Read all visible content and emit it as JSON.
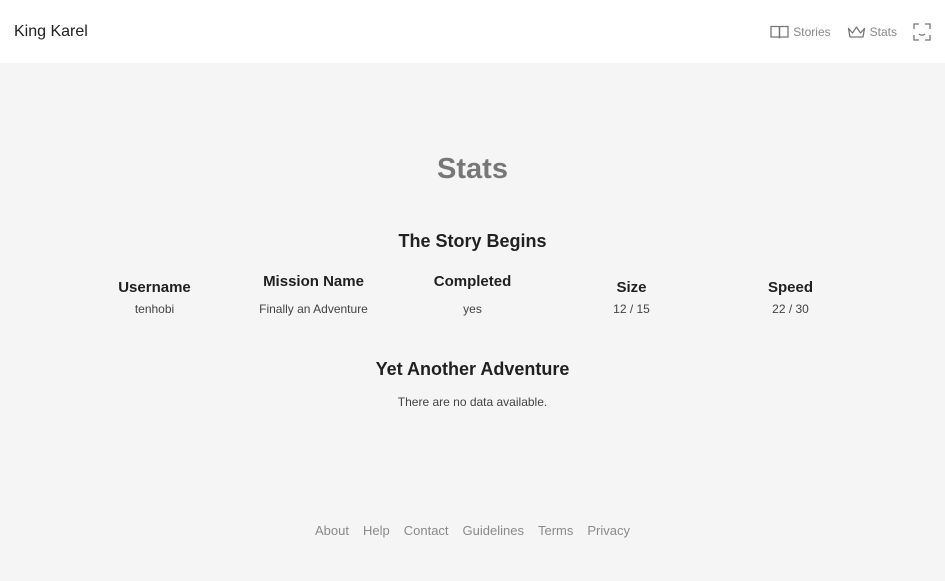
{
  "header": {
    "brand": "King Karel",
    "nav": {
      "stories": "Stories",
      "stats": "Stats"
    }
  },
  "main": {
    "title": "Stats",
    "sections": [
      {
        "title": "The Story Begins",
        "columns": [
          "Username",
          "Mission Name",
          "Completed",
          "Size",
          "Speed"
        ],
        "rows": [
          [
            "tenhobi",
            "Finally an Adventure",
            "yes",
            "12 / 15",
            "22 / 30"
          ]
        ]
      },
      {
        "title": "Yet Another Adventure",
        "empty_message": "There are no data available."
      }
    ]
  },
  "footer": {
    "links": [
      "About",
      "Help",
      "Contact",
      "Guidelines",
      "Terms",
      "Privacy"
    ]
  },
  "icons": {
    "stories": "book-icon",
    "stats": "crown-icon",
    "fullscreen": "fullscreen-icon"
  }
}
